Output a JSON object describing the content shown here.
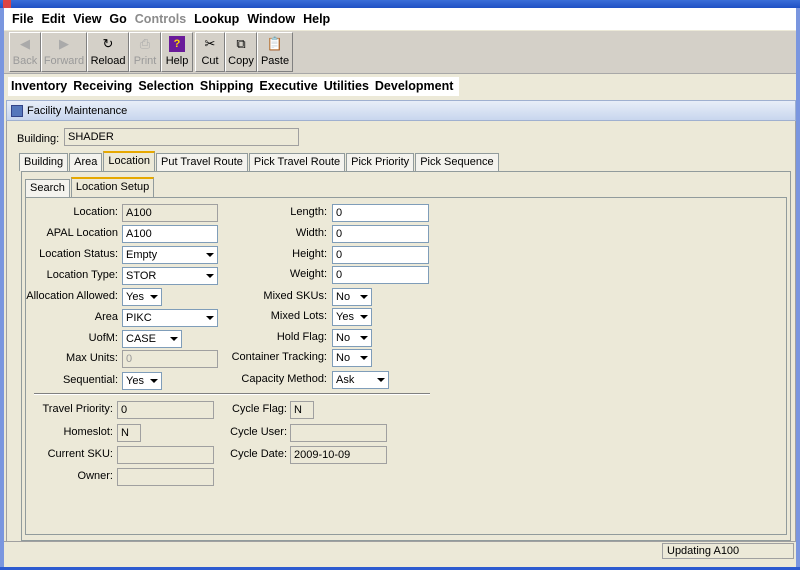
{
  "menu": [
    "File",
    "Edit",
    "View",
    "Go",
    "Controls",
    "Lookup",
    "Window",
    "Help"
  ],
  "toolbar": {
    "back": "Back",
    "forward": "Forward",
    "reload": "Reload",
    "print": "Print",
    "help": "Help",
    "cut": "Cut",
    "copy": "Copy",
    "paste": "Paste"
  },
  "modules": [
    "Inventory",
    "Receiving",
    "Selection",
    "Shipping",
    "Executive",
    "Utilities",
    "Development"
  ],
  "frame_title": "Facility Maintenance",
  "building": {
    "label": "Building:",
    "value": "SHADER"
  },
  "tabs": [
    "Building",
    "Area",
    "Location",
    "Put Travel Route",
    "Pick Travel Route",
    "Pick Priority",
    "Pick Sequence"
  ],
  "subtabs": [
    "Search",
    "Location Setup"
  ],
  "form": {
    "location": {
      "label": "Location:",
      "value": "A100"
    },
    "apal": {
      "label": "APAL Location",
      "value": "A100"
    },
    "status": {
      "label": "Location Status:",
      "value": "Empty"
    },
    "type": {
      "label": "Location Type:",
      "value": "STOR"
    },
    "allocation": {
      "label": "Allocation Allowed:",
      "value": "Yes"
    },
    "area": {
      "label": "Area",
      "value": "PIKC"
    },
    "uofm": {
      "label": "UofM:",
      "value": "CASE"
    },
    "maxunits": {
      "label": "Max Units:",
      "value": "0"
    },
    "sequential": {
      "label": "Sequential:",
      "value": "Yes"
    },
    "length": {
      "label": "Length:",
      "value": "0"
    },
    "width": {
      "label": "Width:",
      "value": "0"
    },
    "height": {
      "label": "Height:",
      "value": "0"
    },
    "weight": {
      "label": "Weight:",
      "value": "0"
    },
    "mixedskus": {
      "label": "Mixed SKUs:",
      "value": "No"
    },
    "mixedlots": {
      "label": "Mixed Lots:",
      "value": "Yes"
    },
    "holdflag": {
      "label": "Hold Flag:",
      "value": "No"
    },
    "container": {
      "label": "Container Tracking:",
      "value": "No"
    },
    "capacity": {
      "label": "Capacity Method:",
      "value": "Ask"
    },
    "travelpriority": {
      "label": "Travel Priority:",
      "value": "0"
    },
    "homeslot": {
      "label": "Homeslot:",
      "value": "N"
    },
    "currentsku": {
      "label": "Current SKU:",
      "value": ""
    },
    "owner": {
      "label": "Owner:",
      "value": ""
    },
    "cycleflag": {
      "label": "Cycle Flag:",
      "value": "N"
    },
    "cycleuser": {
      "label": "Cycle User:",
      "value": ""
    },
    "cycledate": {
      "label": "Cycle Date:",
      "value": "2009-10-09"
    }
  },
  "status": "Updating A100"
}
